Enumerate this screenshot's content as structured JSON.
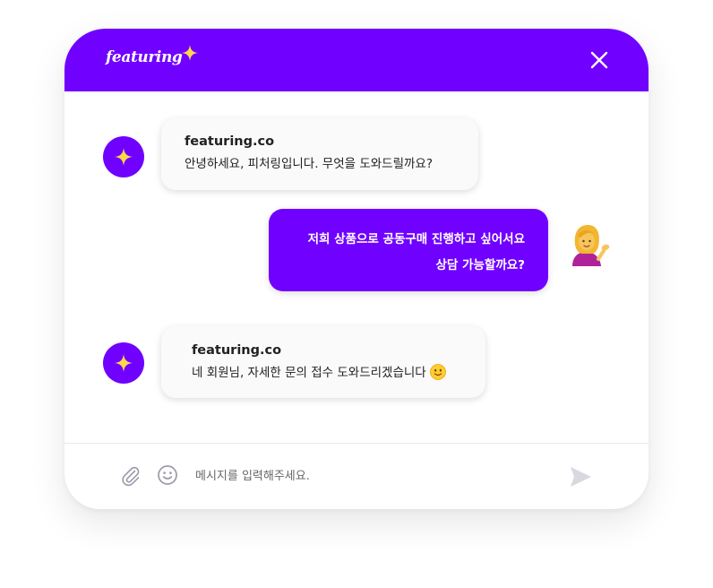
{
  "header": {
    "logo_text": "featuring",
    "brand_color": "#7000ff",
    "close_icon": "close-icon"
  },
  "messages": [
    {
      "sender": "featuring.co",
      "text": "안녕하세요, 피처링입니다. 무엇을 도와드릴까요?",
      "role": "bot"
    },
    {
      "lines": [
        "저희 상품으로 공동구매 진행하고 싶어서요",
        "상담 가능할까요?"
      ],
      "role": "user",
      "avatar": "woman-tipping-hand-emoji"
    },
    {
      "sender": "featuring.co",
      "text": "네 회원님, 자세한 문의 접수 도와드리겠습니다",
      "emoji": "slightly-smiling-face-emoji",
      "role": "bot"
    }
  ],
  "composer": {
    "placeholder": "메시지를 입력해주세요.",
    "value": "",
    "attach_icon": "paperclip-icon",
    "emoji_icon": "smiley-icon",
    "send_icon": "send-icon"
  }
}
